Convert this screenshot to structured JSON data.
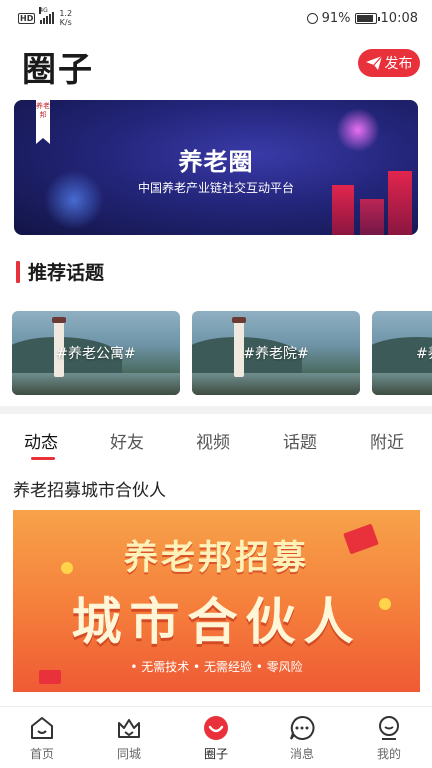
{
  "status_bar": {
    "network": "HD",
    "signal_label": "4G",
    "speed_value": "1.2",
    "speed_unit": "K/s",
    "battery": "91%",
    "time": "10:08"
  },
  "header": {
    "title": "圈子",
    "publish_label": "发布"
  },
  "banner": {
    "ribbon": "养老邦",
    "title": "养老圈",
    "subtitle": "中国养老产业链社交互动平台"
  },
  "recommended": {
    "title": "推荐话题",
    "topics": [
      {
        "label": "#养老公寓#"
      },
      {
        "label": "#养老院#"
      },
      {
        "label": "#养"
      }
    ]
  },
  "tabs": [
    {
      "label": "动态",
      "active": true
    },
    {
      "label": "好友",
      "active": false
    },
    {
      "label": "视频",
      "active": false
    },
    {
      "label": "话题",
      "active": false
    },
    {
      "label": "附近",
      "active": false
    }
  ],
  "post": {
    "title": "养老招募城市合伙人",
    "image_line1": "养老邦招募",
    "image_line2": "城市合伙人",
    "image_bullets": "• 无需技术  • 无需经验  • 零风险"
  },
  "bottom_nav": [
    {
      "label": "首页",
      "icon": "home-icon",
      "active": false
    },
    {
      "label": "同城",
      "icon": "crown-icon",
      "active": false
    },
    {
      "label": "圈子",
      "icon": "circle-icon",
      "active": true
    },
    {
      "label": "消息",
      "icon": "message-icon",
      "active": false
    },
    {
      "label": "我的",
      "icon": "profile-icon",
      "active": false
    }
  ],
  "colors": {
    "accent": "#e8313a",
    "banner_bg": "#23257a",
    "poster_orange": "#f57e3b"
  }
}
